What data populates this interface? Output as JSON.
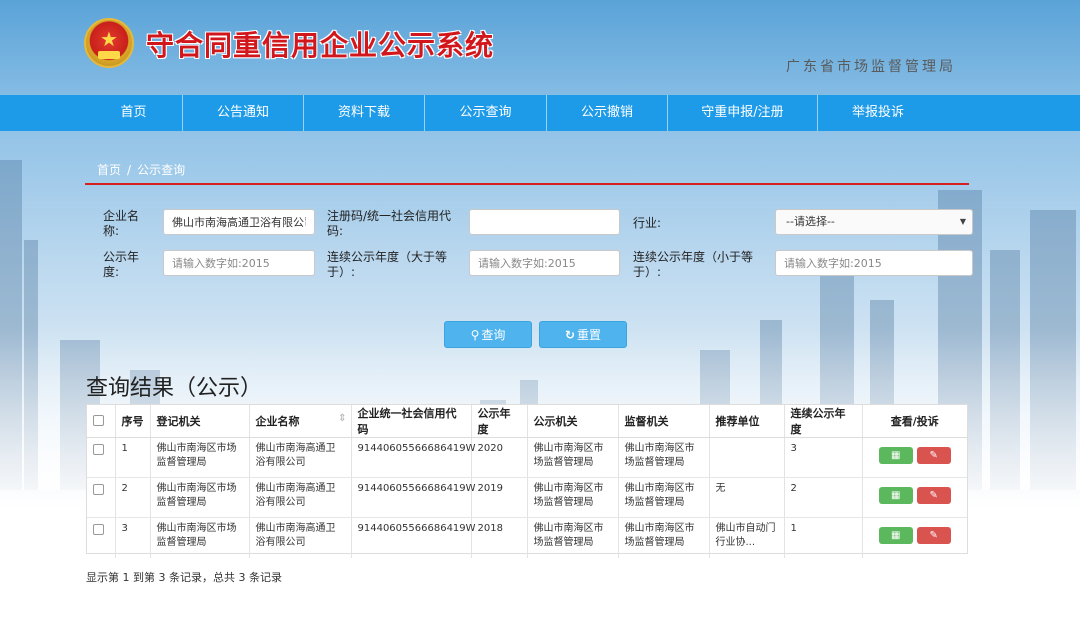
{
  "header": {
    "title": "守合同重信用企业公示系统",
    "agency": "广东省市场监督管理局"
  },
  "nav": [
    {
      "label": "首页"
    },
    {
      "label": "公告通知"
    },
    {
      "label": "资料下载"
    },
    {
      "label": "公示查询"
    },
    {
      "label": "公示撤销"
    },
    {
      "label": "守重申报/注册"
    },
    {
      "label": "举报投诉"
    }
  ],
  "breadcrumb": {
    "home": "首页",
    "sep": "/",
    "current": "公示查询"
  },
  "form": {
    "company_label_1": "企业名",
    "company_label_2": "称:",
    "company_value": "佛山市南海高通卫浴有限公司",
    "code_label_1": "注册码/统一社会信用代",
    "code_label_2": "码:",
    "code_value": "",
    "industry_label": "行业:",
    "industry_value": "--请选择--",
    "year_label_1": "公示年",
    "year_label_2": "度:",
    "year_placeholder": "请输入数字如:2015",
    "cont_ge_label_1": "连续公示年度（大于等",
    "cont_ge_label_2": "于）:",
    "cont_ge_placeholder": "请输入数字如:2015",
    "cont_le_label_1": "连续公示年度（小于等",
    "cont_le_label_2": "于）:",
    "cont_le_placeholder": "请输入数字如:2015",
    "search_label": "查询",
    "reset_label": "重置"
  },
  "results": {
    "title": "查询结果（公示）",
    "columns": [
      "序号",
      "登记机关",
      "企业名称",
      "企业统一社会信用代码",
      "公示年度",
      "公示机关",
      "监督机关",
      "推荐单位",
      "连续公示年度",
      "查看/投诉"
    ],
    "rows": [
      [
        "1",
        "佛山市南海区市场监督管理局",
        "佛山市南海高通卫浴有限公司",
        "91440605566686419W",
        "2020",
        "佛山市南海区市场监督管理局",
        "佛山市南海区市场监督管理局",
        "",
        "3"
      ],
      [
        "2",
        "佛山市南海区市场监督管理局",
        "佛山市南海高通卫浴有限公司",
        "91440605566686419W",
        "2019",
        "佛山市南海区市场监督管理局",
        "佛山市南海区市场监督管理局",
        "无",
        "2"
      ],
      [
        "3",
        "佛山市南海区市场监督管理局",
        "佛山市南海高通卫浴有限公司",
        "91440605566686419W",
        "2018",
        "佛山市南海区市场监督管理局",
        "佛山市南海区市场监督管理局",
        "佛山市自动门行业协...",
        "1"
      ]
    ],
    "summary": "显示第 1 到第 3 条记录，总共 3 条记录"
  },
  "icons": {
    "view": "view-icon",
    "complain": "edit-icon",
    "search": "search-icon",
    "reset": "refresh-icon"
  },
  "colors": {
    "nav": "#1e9be8",
    "title_red": "#d2171c",
    "accent_line": "#d61f1f",
    "button_blue": "#4fb3ee",
    "btn_green": "#5cb85c",
    "btn_red": "#d9534f"
  }
}
